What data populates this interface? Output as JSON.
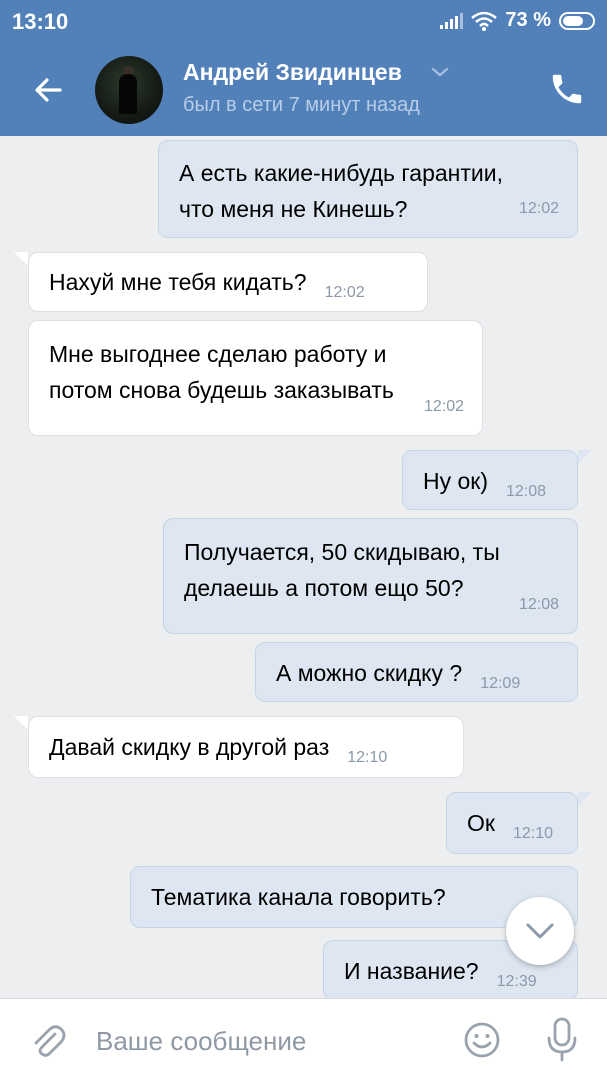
{
  "status_bar": {
    "time": "13:10",
    "battery": "73 %",
    "battery_level": 0.73
  },
  "header": {
    "contact_name": "Андрей Звидинцев",
    "contact_status": "был в сети 7 минут назад",
    "back_icon": "arrow-left-icon",
    "call_icon": "phone-icon",
    "accent_color": "#5181b8"
  },
  "messages": [
    {
      "direction": "out",
      "text_lines": [
        "А есть какие-нибудь гарантии,",
        "что меня не Кинешь?"
      ],
      "time": "12:02"
    },
    {
      "direction": "in",
      "text_lines": [
        "Нахуй мне тебя кидать?"
      ],
      "time": "12:02"
    },
    {
      "direction": "in",
      "text_lines": [
        "Мне выгоднее сделаю работу и",
        "потом снова будешь заказывать"
      ],
      "time": "12:02"
    },
    {
      "direction": "out",
      "text_lines": [
        "Ну ок)"
      ],
      "time": "12:08"
    },
    {
      "direction": "out",
      "text_lines": [
        "Получается, 50 скидываю, ты",
        "делаешь а потом ещо 50?"
      ],
      "time": "12:08"
    },
    {
      "direction": "out",
      "text_lines": [
        "А можно скидку ?"
      ],
      "time": "12:09"
    },
    {
      "direction": "in",
      "text_lines": [
        "Давай скидку в другой раз"
      ],
      "time": "12:10"
    },
    {
      "direction": "out",
      "text_lines": [
        "Ок"
      ],
      "time": "12:10"
    },
    {
      "direction": "out",
      "text_lines": [
        "Тематика канала говорить?"
      ],
      "time": ""
    },
    {
      "direction": "out",
      "text_lines": [
        "И название?"
      ],
      "time": "12:39"
    }
  ],
  "composer": {
    "placeholder": "Ваше сообщение",
    "attach_icon": "paperclip-icon",
    "emoji_icon": "smile-icon",
    "mic_icon": "microphone-icon"
  },
  "scroll_button_icon": "chevron-down-icon"
}
